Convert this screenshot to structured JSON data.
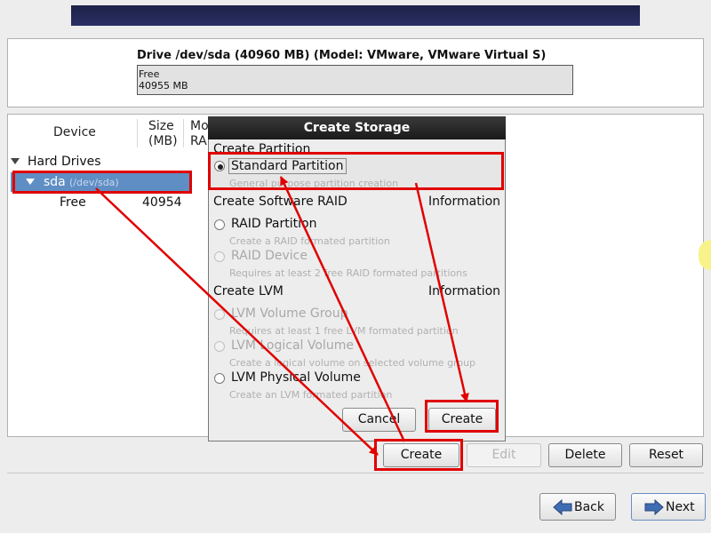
{
  "drive": {
    "title": "Drive /dev/sda (40960 MB) (Model: VMware, VMware Virtual S)",
    "bar_label": "Free",
    "bar_size": "40955 MB"
  },
  "columns": {
    "device": "Device",
    "size_line1": "Size",
    "size_line2": "(MB)",
    "mount_line1": "Mo",
    "mount_line2": "RAI"
  },
  "tree": {
    "group": "Hard Drives",
    "disk_name": "sda",
    "disk_path": "(/dev/sda)",
    "free_label": "Free",
    "free_size": "40954"
  },
  "dialog": {
    "title": "Create Storage",
    "section_partition": "Create Partition",
    "standard_partition": "Standard Partition",
    "standard_partition_desc": "General purpose partition creation",
    "section_raid": "Create Software RAID",
    "raid_info": "Information",
    "raid_partition": "RAID Partition",
    "raid_partition_desc": "Create a RAID formated partition",
    "raid_device": "RAID Device",
    "raid_device_desc": "Requires at least 2 free RAID formated partitions",
    "section_lvm": "Create LVM",
    "lvm_info": "Information",
    "lvm_volume_group": "LVM Volume Group",
    "lvm_volume_group_desc": "Requires at least 1 free LVM formated partition",
    "lvm_logical_volume": "LVM Logical Volume",
    "lvm_logical_volume_desc": "Create a logical volume on selected volume group",
    "lvm_physical_volume": "LVM Physical Volume",
    "lvm_physical_volume_desc": "Create an LVM formated partition",
    "cancel": "Cancel",
    "create": "Create"
  },
  "actions": {
    "create": "Create",
    "edit": "Edit",
    "delete": "Delete",
    "reset": "Reset"
  },
  "nav": {
    "back": "Back",
    "next": "Next"
  },
  "colors": {
    "annotation": "#e00000",
    "selection": "#5f8ec4"
  }
}
